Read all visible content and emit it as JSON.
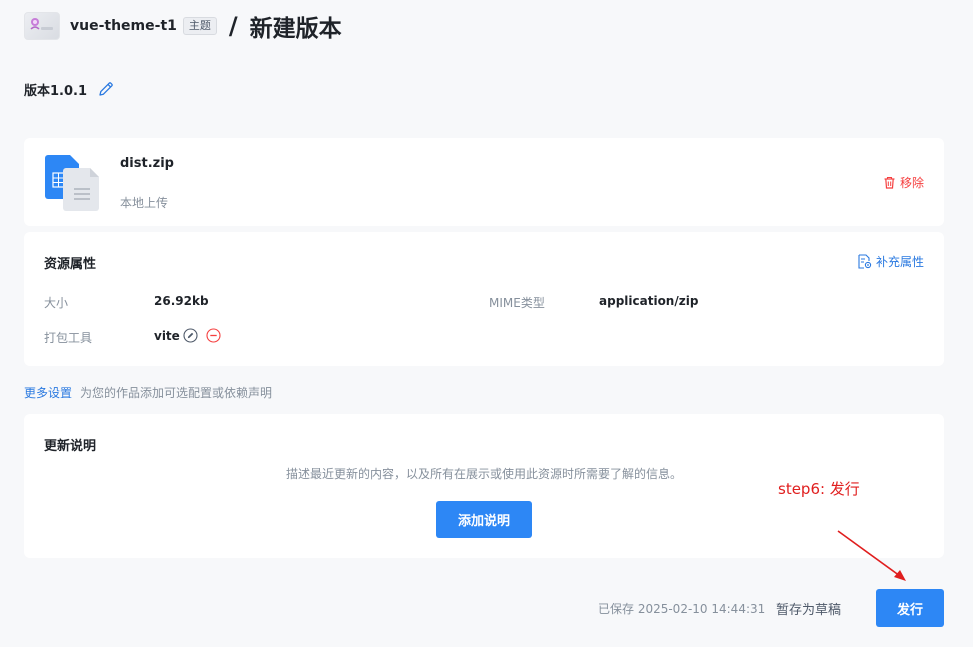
{
  "header": {
    "project_name": "vue-theme-t1",
    "tag": "主题",
    "separator": "/",
    "title": "新建版本"
  },
  "version": {
    "label": "版本1.0.1",
    "edit_icon": "pencil-icon"
  },
  "file": {
    "name": "dist.zip",
    "source": "本地上传",
    "icon": "document-file-icon",
    "remove_label": "移除",
    "remove_icon": "trash-icon"
  },
  "properties": {
    "title": "资源属性",
    "add_label": "补充属性",
    "add_icon": "settings-file-icon",
    "items": [
      {
        "label": "大小",
        "value": "26.92kb"
      },
      {
        "label": "MIME类型",
        "value": "application/zip"
      },
      {
        "label": "打包工具",
        "value": "vite"
      }
    ]
  },
  "more_settings": {
    "link": "更多设置",
    "description": "为您的作品添加可选配置或依赖声明"
  },
  "notes": {
    "title": "更新说明",
    "description": "描述最近更新的内容，以及所有在展示或使用此资源时所需要了解的信息。",
    "button": "添加说明"
  },
  "annotation": {
    "text": "step6: 发行",
    "color": "#e01e1e"
  },
  "footer": {
    "saved": "已保存 2025-02-10 14:44:31",
    "draft_button": "暂存为草稿",
    "publish_button": "发行"
  },
  "colors": {
    "primary": "#2d87f5",
    "link": "#2a79e0",
    "danger": "#f53f3f",
    "background": "#f7f8fa"
  }
}
